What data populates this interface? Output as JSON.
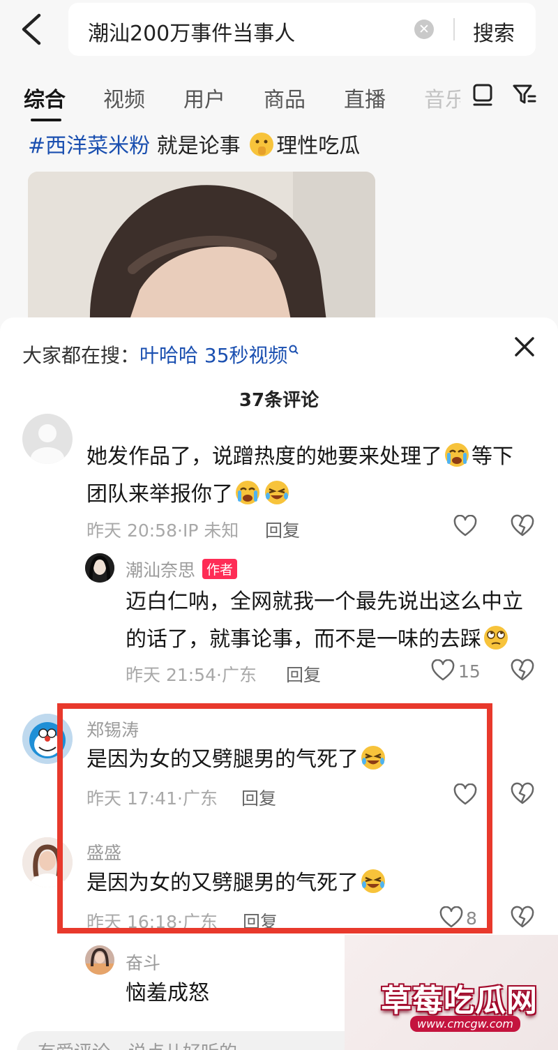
{
  "search": {
    "query": "潮汕200万事件当事人",
    "button_label": "搜索"
  },
  "tabs": [
    {
      "label": "综合",
      "active": true
    },
    {
      "label": "视频"
    },
    {
      "label": "用户"
    },
    {
      "label": "商品"
    },
    {
      "label": "直播"
    },
    {
      "label": "音乐"
    }
  ],
  "post": {
    "hashtag": "#西洋菜米粉",
    "caption_text": " 就是论事",
    "caption_tail": "理性吃瓜"
  },
  "sheet": {
    "hint_prefix": "大家都在搜：",
    "hint_link": "叶哈哈 35秒视频",
    "comment_count": "37条评论"
  },
  "comments": [
    {
      "name": "",
      "text_1": "她发作品了，说蹭热度的她要来处理了",
      "text_2": "等下",
      "text_3": "团队来举报你了",
      "meta": "昨天 20:58·IP 未知",
      "reply_label": "回复",
      "likes": ""
    },
    {
      "name": "潮汕奈思",
      "author_badge": "作者",
      "text_1": "迈白仁呐，全网就我一个最先说出这么中立",
      "text_2": "的话了，就事论事，而不是一味的去踩",
      "meta": "昨天 21:54·广东",
      "reply_label": "回复",
      "likes": "15"
    },
    {
      "name": "郑锡涛",
      "text_1": "是因为女的又劈腿男的气死了",
      "meta": "昨天 17:41·广东",
      "reply_label": "回复",
      "likes": ""
    },
    {
      "name": "盛盛",
      "text_1": "是因为女的又劈腿男的气死了",
      "meta": "昨天 16:18·广东",
      "reply_label": "回复",
      "likes": "8"
    },
    {
      "name": "奋斗",
      "text_1": "恼羞成怒"
    }
  ],
  "input": {
    "placeholder": "有爱评论，说点儿好听的"
  },
  "watermark": {
    "title": "草莓吃瓜网",
    "url": "www.cmcgw.com"
  },
  "colors": {
    "link": "#1a4fb0",
    "author_badge": "#fe2c55",
    "highlight_box": "#e8392c"
  }
}
